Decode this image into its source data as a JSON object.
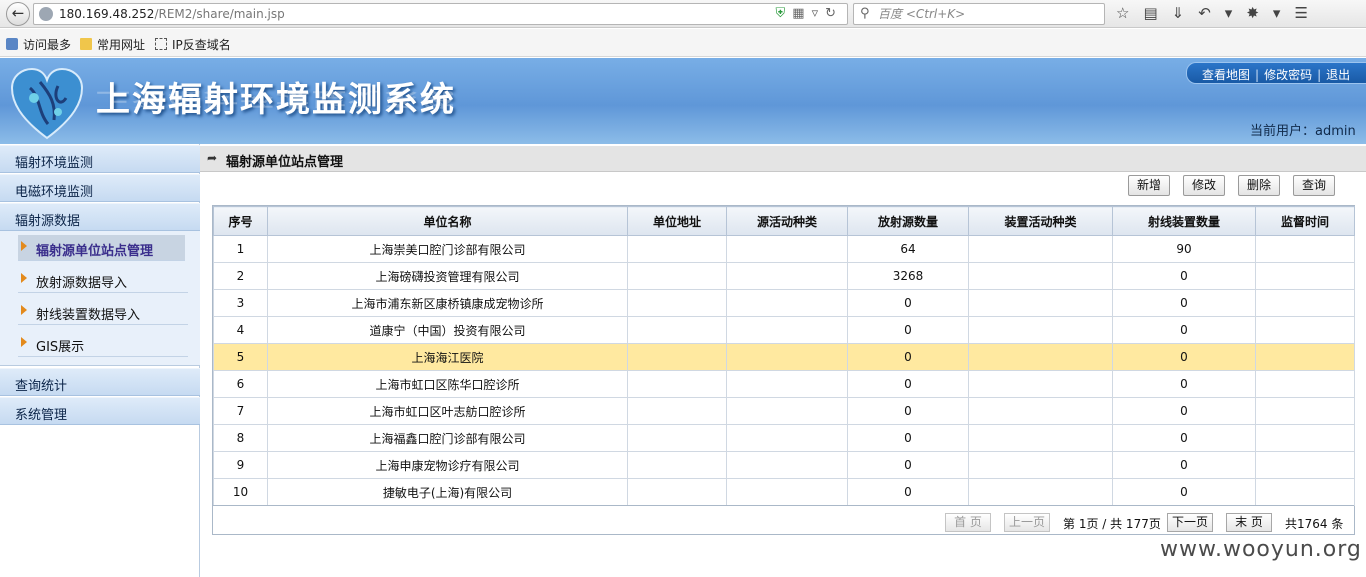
{
  "browser": {
    "url_host": "180.169.48.252",
    "url_path": "/REM2/share/main.jsp",
    "search_placeholder": "百度 <Ctrl+K>",
    "bookmarks": [
      {
        "label": "访问最多",
        "icon": "page-icon"
      },
      {
        "label": "常用网址",
        "icon": "folder-icon"
      },
      {
        "label": "IP反查域名",
        "icon": "bookmark-icon"
      }
    ]
  },
  "header": {
    "system_title": "上海辐射环境监测系统",
    "links": [
      "查看地图",
      "修改密码",
      "退出"
    ],
    "current_user_label": "当前用户：",
    "current_user": "admin"
  },
  "sidebar": {
    "categories": [
      "辐射环境监测",
      "电磁环境监测",
      "辐射源数据",
      "查询统计",
      "系统管理"
    ],
    "sub_items": [
      "辐射源单位站点管理",
      "放射源数据导入",
      "射线装置数据导入",
      "GIS展示"
    ],
    "active_sub": 0
  },
  "main": {
    "title": "辐射源单位站点管理",
    "actions": [
      "新增",
      "修改",
      "删除",
      "查询"
    ],
    "columns": [
      "序号",
      "单位名称",
      "单位地址",
      "源活动种类",
      "放射源数量",
      "装置活动种类",
      "射线装置数量",
      "监督时间"
    ],
    "rows": [
      [
        "1",
        "上海崇美口腔门诊部有限公司",
        "",
        "",
        "64",
        "",
        "90",
        ""
      ],
      [
        "2",
        "上海磅礴投资管理有限公司",
        "",
        "",
        "3268",
        "",
        "0",
        ""
      ],
      [
        "3",
        "上海市浦东新区康桥镇康成宠物诊所",
        "",
        "",
        "0",
        "",
        "0",
        ""
      ],
      [
        "4",
        "道康宁（中国）投资有限公司",
        "",
        "",
        "0",
        "",
        "0",
        ""
      ],
      [
        "5",
        "上海海江医院",
        "",
        "",
        "0",
        "",
        "0",
        ""
      ],
      [
        "6",
        "上海市虹口区陈华口腔诊所",
        "",
        "",
        "0",
        "",
        "0",
        ""
      ],
      [
        "7",
        "上海市虹口区叶志舫口腔诊所",
        "",
        "",
        "0",
        "",
        "0",
        ""
      ],
      [
        "8",
        "上海福鑫口腔门诊部有限公司",
        "",
        "",
        "0",
        "",
        "0",
        ""
      ],
      [
        "9",
        "上海申康宠物诊疗有限公司",
        "",
        "",
        "0",
        "",
        "0",
        ""
      ],
      [
        "10",
        "捷敏电子(上海)有限公司",
        "",
        "",
        "0",
        "",
        "0",
        ""
      ]
    ],
    "highlighted_row": 4
  },
  "pager": {
    "first": "首 页",
    "prev": "上一页",
    "page_info": "第 1页 / 共 177页",
    "next": "下一页",
    "last": "末 页",
    "total": "共1764 条"
  },
  "watermark": "www.wooyun.org"
}
